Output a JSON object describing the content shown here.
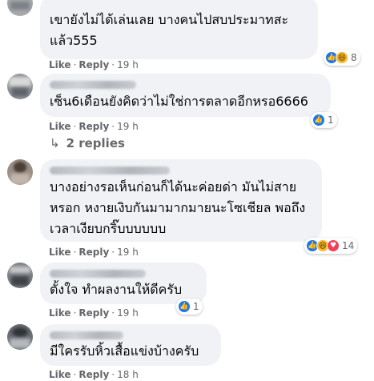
{
  "comments": [
    {
      "text_lines": [
        "เขายังไม่ได้เล่นเลย บางคนไปสบประมาทสะ",
        "แล้ว555"
      ],
      "like_label": "Like",
      "reply_label": "Reply",
      "time": "19 h",
      "reactions": [
        "like",
        "haha"
      ],
      "reaction_count": "8"
    },
    {
      "text_lines": [
        "เซ็น6เดือนยังคิดว่าไม่ใช่การตลาดอีกหรอ6666"
      ],
      "like_label": "Like",
      "reply_label": "Reply",
      "time": "19 h",
      "reactions": [
        "like"
      ],
      "reaction_count": "1"
    },
    {
      "text_lines": [
        "บางอย่างรอเห็นก่อนก็ได้นะค่อยด่า มันไม่สาย",
        "หรอก หงายเงิบกันมามากมายนะโซเชียล พอถึง",
        "เวลาเงียบกริ๊บบบบบบ"
      ],
      "like_label": "Like",
      "reply_label": "Reply",
      "time": "19 h",
      "reactions": [
        "like",
        "haha",
        "love"
      ],
      "reaction_count": "14"
    },
    {
      "text_lines": [
        "ตั้งใจ ทำผลงานให้ดีครับ"
      ],
      "like_label": "Like",
      "reply_label": "Reply",
      "time": "19 h",
      "reactions": [
        "like"
      ],
      "reaction_count": "1"
    },
    {
      "text_lines": [
        "มีใครรับหิ้วเสื้อแข่งบ้างครับ"
      ],
      "like_label": "Like",
      "reply_label": "Reply",
      "time": "18 h",
      "reactions": [],
      "reaction_count": ""
    }
  ],
  "replies_link": {
    "arrow": "↳",
    "label": "2 replies"
  },
  "colors": {
    "bubble": "#f0f2f5",
    "meta": "#65676b",
    "like": "#1877f2",
    "haha": "#f7b928",
    "love": "#f33e58"
  },
  "icons": {
    "like": "thumbs-up",
    "haha": "laughing-face",
    "love": "heart"
  }
}
